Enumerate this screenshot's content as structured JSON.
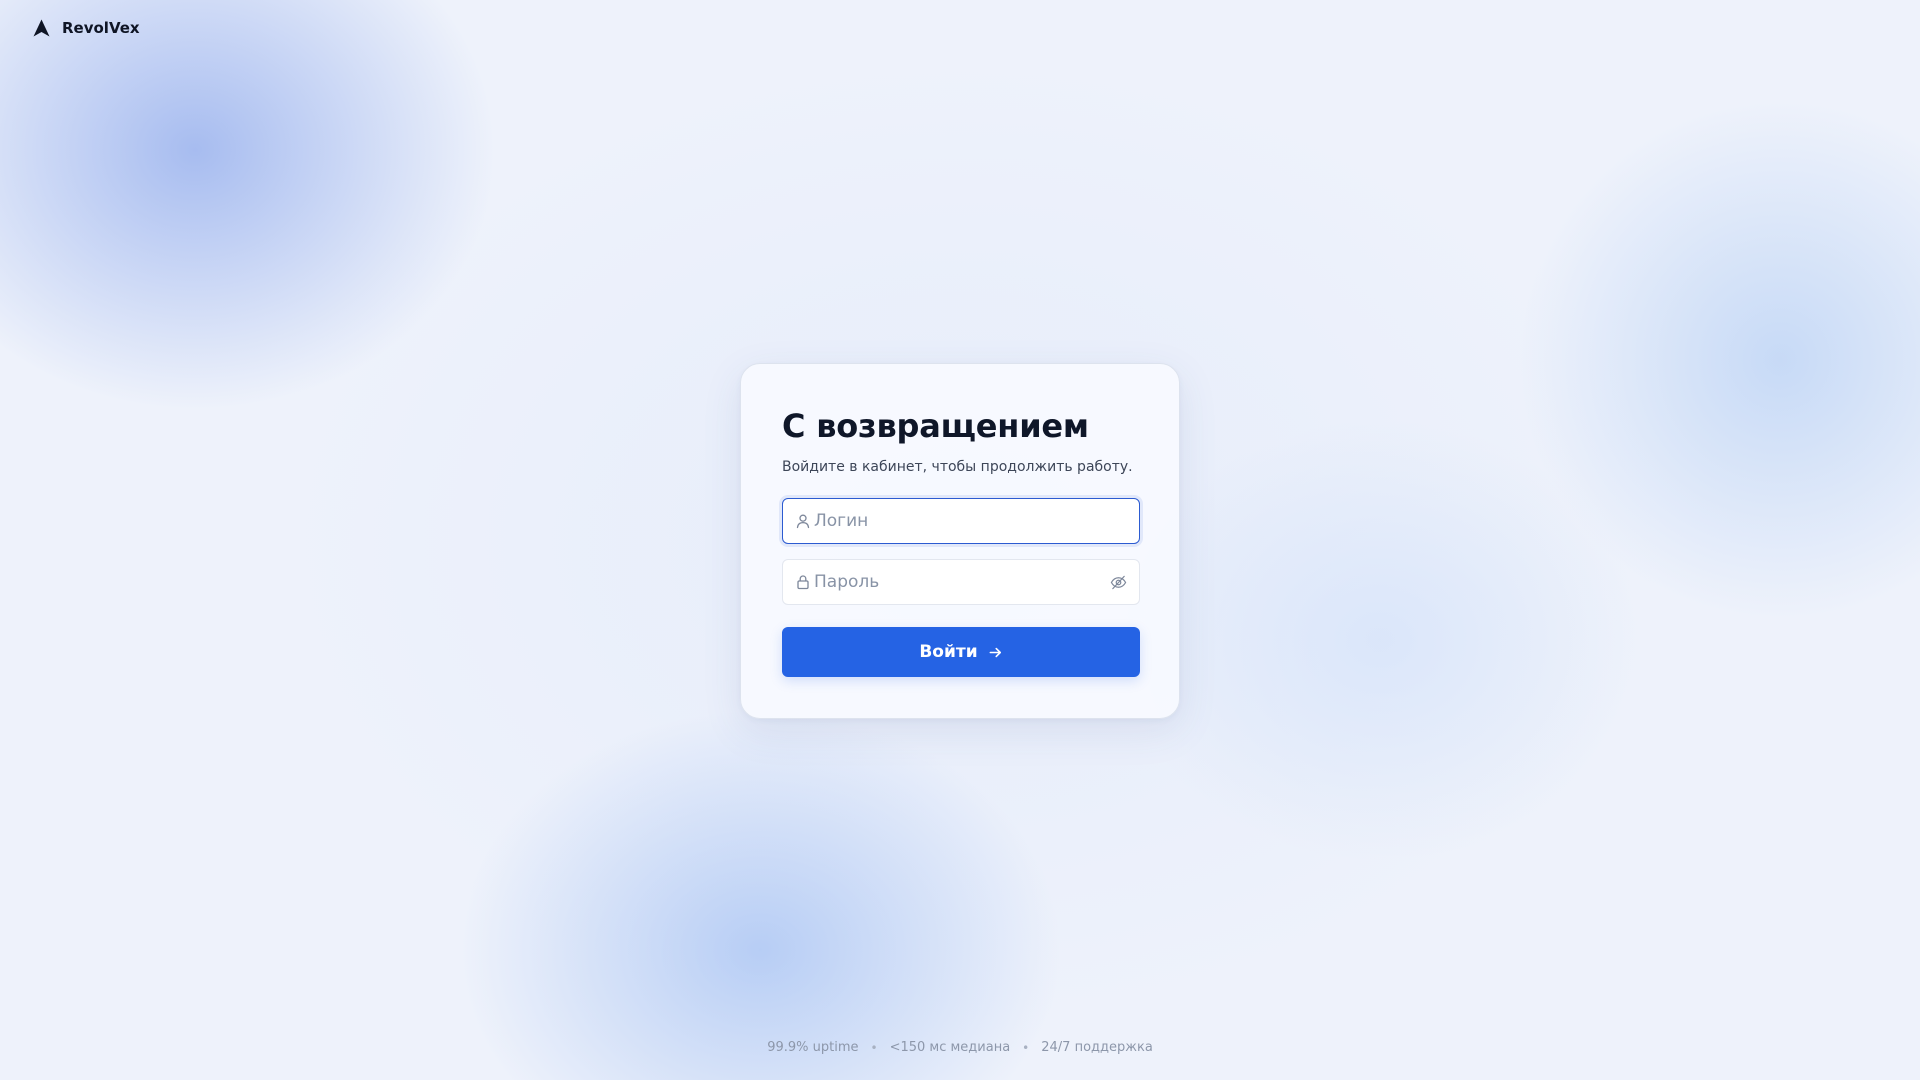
{
  "brand": {
    "name": "RevolVex",
    "logo_icon": "arrow-navigation-icon"
  },
  "login_card": {
    "title": "С возвращением",
    "subtitle": "Войдите в кабинет, чтобы продолжить работу.",
    "login_field": {
      "placeholder": "Логин",
      "value": "",
      "icon": "user-icon",
      "focused": true
    },
    "password_field": {
      "placeholder": "Пароль",
      "value": "",
      "icon": "lock-icon",
      "toggle_icon": "eye-off-icon"
    },
    "submit": {
      "label": "Войти",
      "icon": "arrow-right-icon"
    }
  },
  "footer": {
    "items": [
      "99.9% uptime",
      "<150 мс медиана",
      "24/7 поддержка"
    ],
    "separator": "•"
  },
  "colors": {
    "accent": "#2563e4",
    "focus_border": "#2c5bd1",
    "title": "#0f1729",
    "background": "#eef2fb"
  }
}
